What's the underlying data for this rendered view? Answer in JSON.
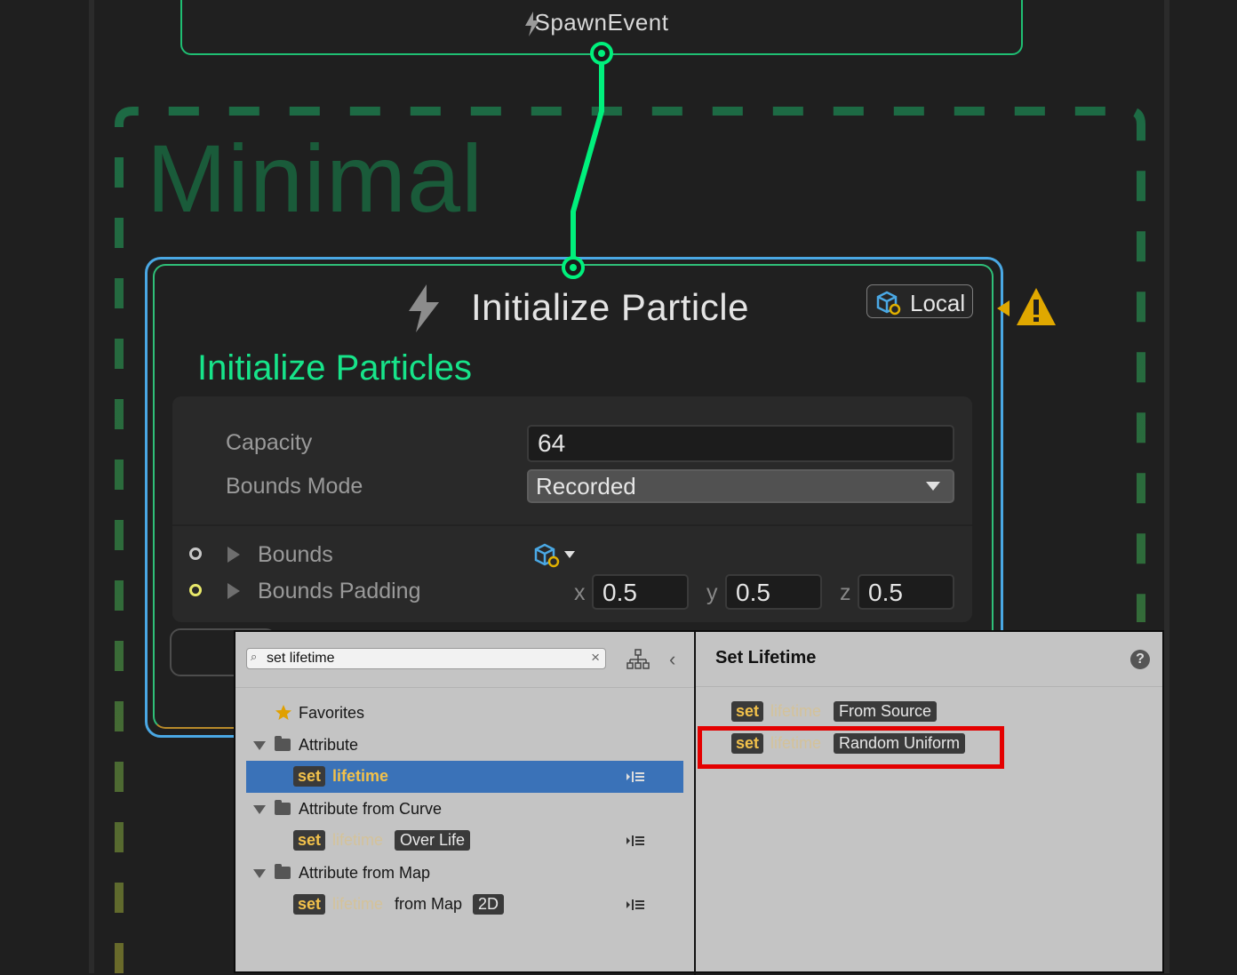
{
  "spawn_node": {
    "title": "SpawnEvent"
  },
  "group": {
    "title": "Minimal"
  },
  "init_node": {
    "title": "Initialize Particle",
    "space_button": "Local",
    "block_title": "Initialize Particles",
    "fields": {
      "capacity_label": "Capacity",
      "capacity_value": "64",
      "bounds_mode_label": "Bounds Mode",
      "bounds_mode_value": "Recorded",
      "bounds_label": "Bounds",
      "bounds_padding_label": "Bounds Padding",
      "x_label": "x",
      "x_value": "0.5",
      "y_label": "y",
      "y_value": "0.5",
      "z_label": "z",
      "z_value": "0.5"
    }
  },
  "search_popup": {
    "query": "set lifetime",
    "list": {
      "favorites": "Favorites",
      "attribute": "Attribute",
      "attribute_from_curve": "Attribute from Curve",
      "attribute_from_map": "Attribute from Map",
      "item1": {
        "set": "set",
        "attr": "lifetime"
      },
      "item2": {
        "set": "set",
        "attr": "lifetime",
        "suffix": "Over Life"
      },
      "item3": {
        "set": "set",
        "attr": "lifetime",
        "mid": "from Map",
        "suffix": "2D"
      }
    },
    "detail": {
      "title": "Set Lifetime",
      "help": "?",
      "option1": {
        "set": "set",
        "attr": "lifetime",
        "suffix": "From Source"
      },
      "option2": {
        "set": "set",
        "attr": "lifetime",
        "suffix": "Random Uniform"
      }
    }
  },
  "colors": {
    "flow_link": "#00f07c",
    "group_border": "#1f6d45",
    "selection": "#3a72b8",
    "warning": "#e0a800",
    "highlight": "#e40000"
  }
}
